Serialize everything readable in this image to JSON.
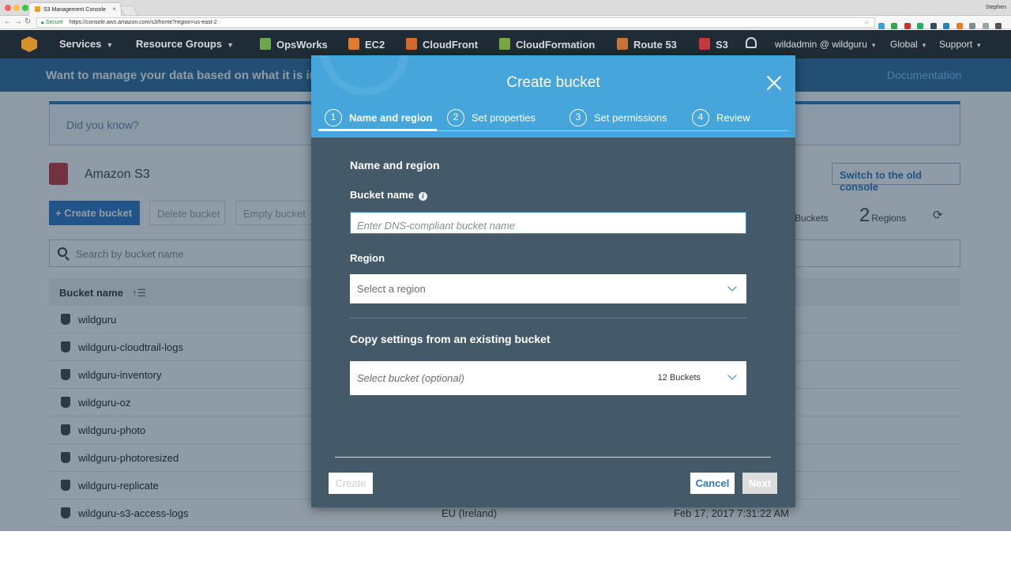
{
  "browser": {
    "tab_title": "S3 Management Console",
    "tab_close": "×",
    "profile_name": "Stephen",
    "secure_label": "Secure",
    "url": "https://console.aws.amazon.com/s3/home?region=us-east-2",
    "back": "←",
    "forward": "→",
    "reload": "↻",
    "star": "☆",
    "traffic_colors": [
      "#fc605c",
      "#fdbc40",
      "#34c84a"
    ]
  },
  "nav": {
    "services": "Services",
    "resource_groups": "Resource Groups",
    "shortcuts": [
      {
        "label": "OpsWorks",
        "color": "#6aa84f"
      },
      {
        "label": "EC2",
        "color": "#e07b2a"
      },
      {
        "label": "CloudFront",
        "color": "#d46b2b"
      },
      {
        "label": "CloudFormation",
        "color": "#7aa53f"
      },
      {
        "label": "Route 53",
        "color": "#c7733a"
      },
      {
        "label": "S3",
        "color": "#c7373b"
      }
    ],
    "account": "wildadmin @ wildguru",
    "region": "Global",
    "support": "Support",
    "caret": "▾"
  },
  "banner": {
    "message": "Want to manage your data based on what it is inst",
    "documentation": "Documentation"
  },
  "page": {
    "did_you_know": "Did you know?",
    "title": "Amazon S3",
    "old_console": "Switch to the old console",
    "create_bucket": "+ Create bucket",
    "delete_bucket": "Delete bucket",
    "empty_bucket": "Empty bucket",
    "buckets_stat": "Buckets",
    "regions_count": "2",
    "regions_label": "Regions",
    "refresh": "⟳",
    "search_placeholder": "Search by bucket name",
    "col_bucket_name": "Bucket name",
    "sort_icon": "↑☰",
    "buckets": [
      {
        "name": "wildguru",
        "region": "",
        "date": ""
      },
      {
        "name": "wildguru-cloudtrail-logs",
        "region": "",
        "date": ""
      },
      {
        "name": "wildguru-inventory",
        "region": "",
        "date": ""
      },
      {
        "name": "wildguru-oz",
        "region": "",
        "date": ""
      },
      {
        "name": "wildguru-photo",
        "region": "",
        "date": ""
      },
      {
        "name": "wildguru-photoresized",
        "region": "",
        "date": ""
      },
      {
        "name": "wildguru-replicate",
        "region": "",
        "date": ""
      },
      {
        "name": "wildguru-s3-access-logs",
        "region": "EU (Ireland)",
        "date": "Feb 17, 2017 7:31:22 AM"
      }
    ]
  },
  "modal": {
    "title": "Create bucket",
    "steps": [
      {
        "num": "1",
        "label": "Name and region",
        "active": true
      },
      {
        "num": "2",
        "label": "Set properties",
        "active": false
      },
      {
        "num": "3",
        "label": "Set permissions",
        "active": false
      },
      {
        "num": "4",
        "label": "Review",
        "active": false
      }
    ],
    "section_title": "Name and region",
    "bucket_name_label": "Bucket name",
    "bucket_name_info": "i",
    "bucket_name_placeholder": "Enter DNS-compliant bucket name",
    "bucket_name_value": "",
    "region_label": "Region",
    "region_placeholder": "Select a region",
    "copy_title": "Copy settings from an existing bucket",
    "copy_placeholder": "Select bucket (optional)",
    "copy_count": "12 Buckets",
    "create_button": "Create",
    "cancel_button": "Cancel",
    "next_button": "Next"
  }
}
